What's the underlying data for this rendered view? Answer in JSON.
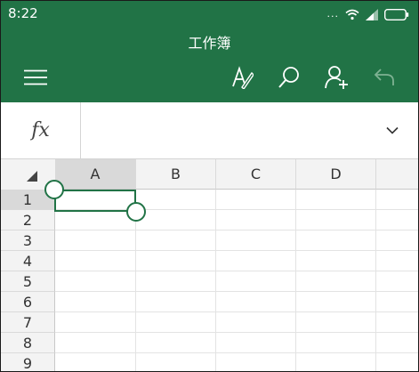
{
  "status": {
    "time": "8:22",
    "overflow_dots": "..."
  },
  "app": {
    "title": "工作簿",
    "accent": "#217346"
  },
  "toolbar": {
    "icons": [
      "menu-icon",
      "edit-format-icon",
      "search-icon",
      "share-person-add-icon",
      "undo-icon"
    ]
  },
  "formula_bar": {
    "fx_label": "fx",
    "value": "",
    "expand_icon": "chevron-down-icon"
  },
  "sheet": {
    "columns": [
      "A",
      "B",
      "C",
      "D"
    ],
    "rows": [
      "1",
      "2",
      "3",
      "4",
      "5",
      "6",
      "7",
      "8",
      "9"
    ],
    "selected_cell": "A1"
  }
}
